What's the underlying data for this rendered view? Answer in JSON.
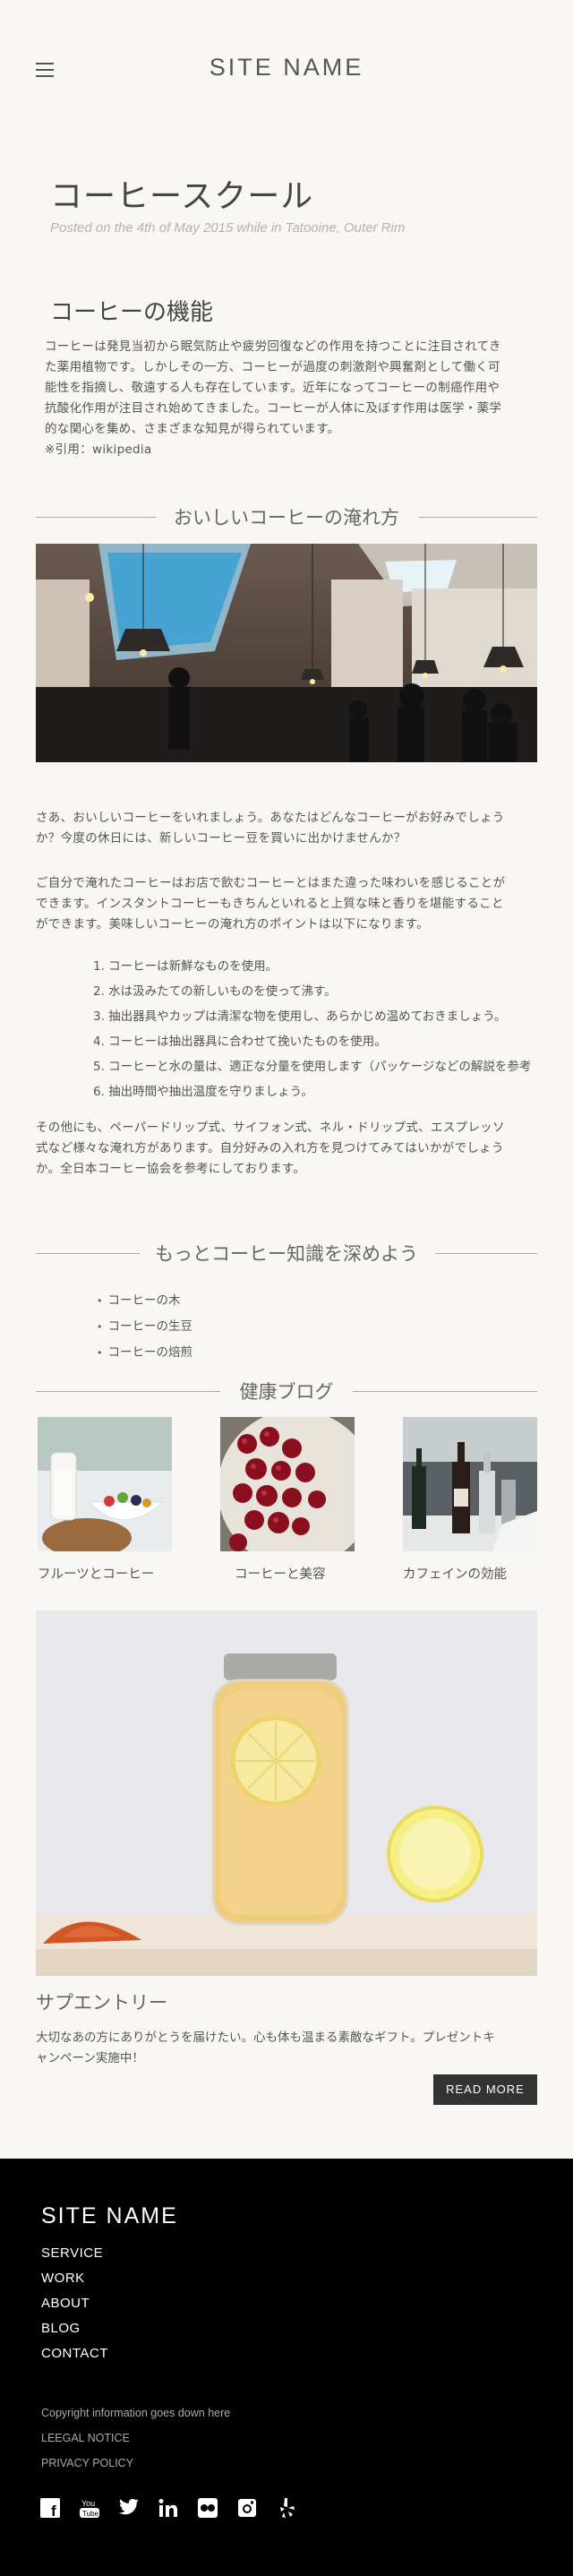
{
  "header": {
    "site_name": "SITE NAME"
  },
  "post": {
    "title": "コーヒースクール",
    "meta": "Posted on the 4th of May 2015 while in Tatooine, Outer Rim"
  },
  "section_function": {
    "heading": "コーヒーの機能",
    "line1": "コーヒーは発見当初から眠気防止や疲労回復などの作用を持つことに注目されてき",
    "line2": "た薬用植物です。しかしその一方、コーヒーが過度の刺激剤や興奮剤として働く可",
    "line3": "能性を指摘し、敬遠する人も存在しています。近年になってコーヒーの制癌作用や",
    "line4": "抗酸化作用が注目され始めてきました。コーヒーが人体に及ぼす作用は医学・薬学",
    "line5": "的な関心を集め、さまざまな知見が得られています。",
    "line6": "※引用：wikipedia"
  },
  "section_brew": {
    "heading": "おいしいコーヒーの淹れ方",
    "intro1": "さあ、おいしいコーヒーをいれましょう。あなたはどんなコーヒーがお好みでしょう",
    "intro2": "か？今度の休日には、新しいコーヒー豆を買いに出かけませんか？",
    "p2_1": "ご自分で淹れたコーヒーはお店で飲むコーヒーとはまた違った味わいを感じることが",
    "p2_2": "できます。インスタントコーヒーもきちんといれると上質な味と香りを堪能すること",
    "p2_3": "ができます。美味しいコーヒーの淹れ方のポイントは以下になります。",
    "steps": [
      "1. コーヒーは新鮮なものを使用。",
      "2. 水は汲みたての新しいものを使って沸す。",
      "3. 抽出器具やカップは清潔な物を使用し、あらかじめ温めておきましょう。",
      "4. コーヒーは抽出器具に合わせて挽いたものを使用。",
      "5. コーヒーと水の量は、適正な分量を使用します（パッケージなどの解説を参考",
      "6. 抽出時間や抽出温度を守りましょう。"
    ],
    "p3_1": "その他にも、ペーパードリップ式、サイフォン式、ネル・ドリップ式、エスプレッソ",
    "p3_2": "式など様々な淹れ方があります。自分好みの入れ方を見つけてみてはいかがでしょう",
    "p3_3": "か。全日本コーヒー協会を参考にしております。"
  },
  "section_more": {
    "heading": "もっとコーヒー知識を深めよう",
    "links": [
      "コーヒーの木",
      "コーヒーの生豆",
      "コーヒーの焙煎"
    ]
  },
  "blog": {
    "heading": "健康ブログ",
    "cards": [
      {
        "caption": "フルーツとコーヒー"
      },
      {
        "caption": "コーヒーと美容"
      },
      {
        "caption": "カフェインの効能"
      }
    ]
  },
  "feature": {
    "title": "サプエントリー",
    "text1": "大切なあの方にありがとうを届けたい。心も体も温まる素敵なギフト。プレゼントキ",
    "text2": "ャンペーン実施中！",
    "button": "READ MORE"
  },
  "footer": {
    "site_name": "SITE NAME",
    "menu": [
      "SERVICE",
      "WORK",
      "ABOUT",
      "BLOG",
      "CONTACT"
    ],
    "copyright": "Copyright information goes down here",
    "legal": "LEEGAL NOTICE",
    "privacy": "PRIVACY POLICY",
    "socials": [
      "facebook-icon",
      "youtube-icon",
      "twitter-icon",
      "linkedin-icon",
      "flickr-icon",
      "instagram-icon",
      "yelp-icon"
    ]
  },
  "colors": {
    "background": "#f9f7f3",
    "footer": "#000000",
    "button": "#333333"
  }
}
